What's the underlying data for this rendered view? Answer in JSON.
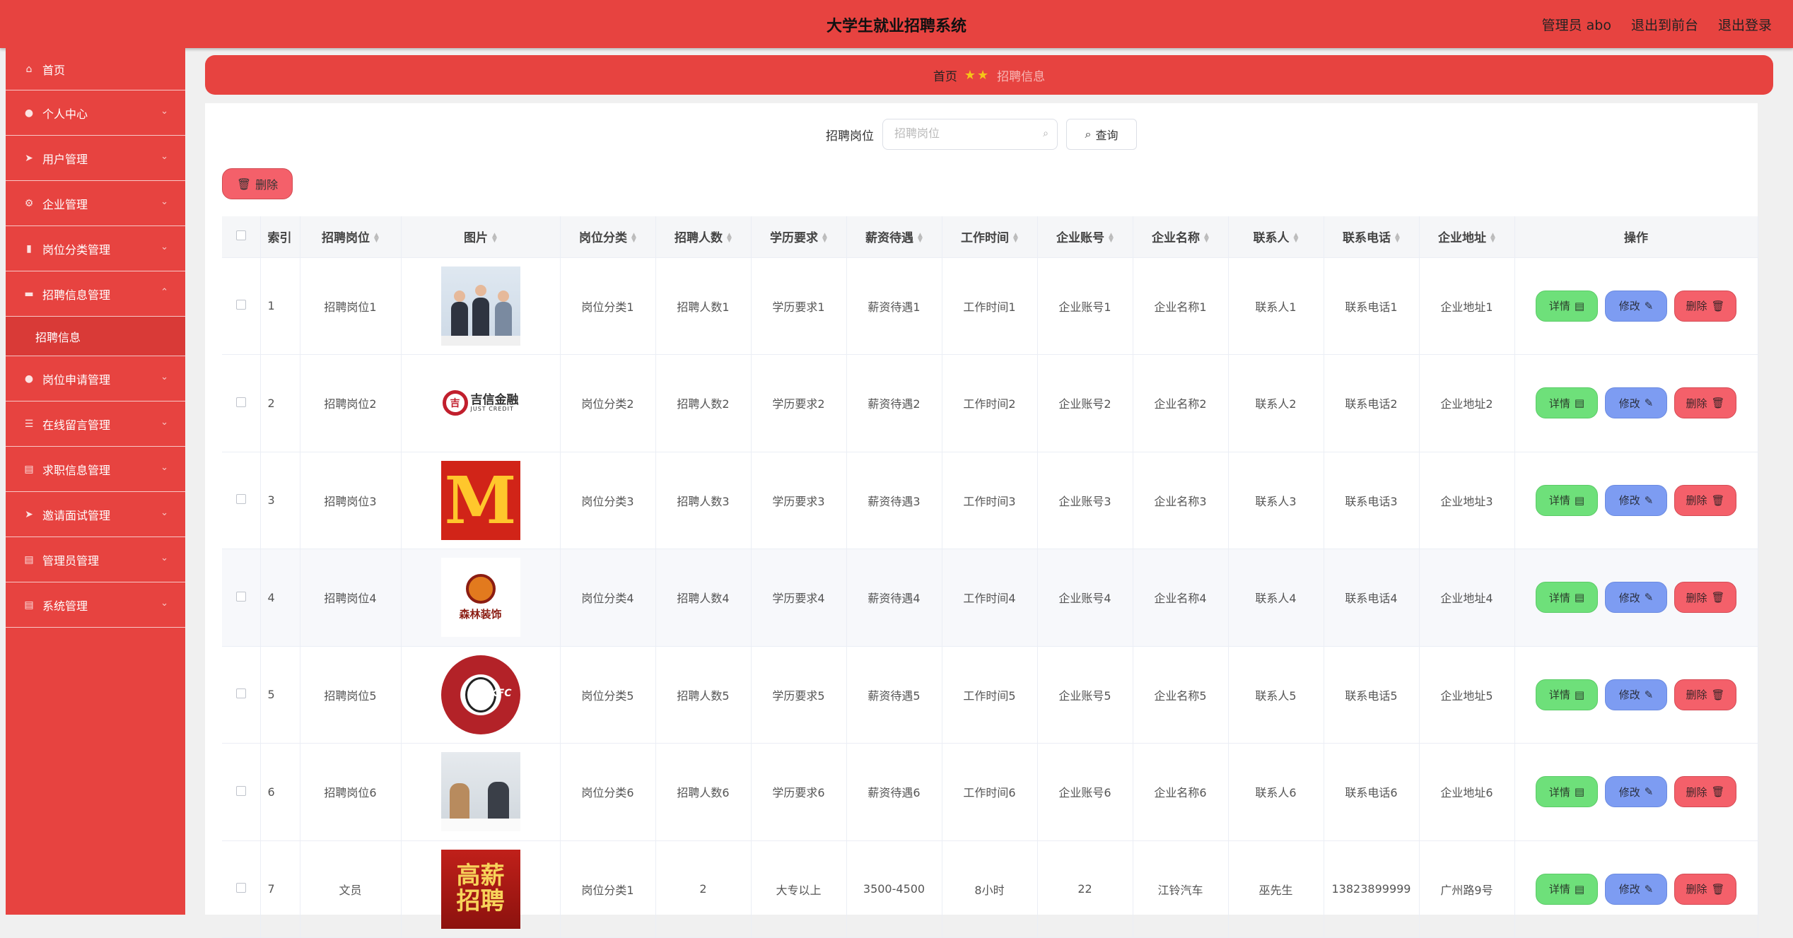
{
  "header": {
    "title": "大学生就业招聘系统",
    "admin": "管理员 abo",
    "exit_front": "退出到前台",
    "logout": "退出登录"
  },
  "sidebar": {
    "items": [
      {
        "label": "首页",
        "icon": "home-icon"
      },
      {
        "label": "个人中心",
        "icon": "user-icon"
      },
      {
        "label": "用户管理",
        "icon": "send-icon"
      },
      {
        "label": "企业管理",
        "icon": "gear-icon"
      },
      {
        "label": "岗位分类管理",
        "icon": "bar-chart-icon"
      },
      {
        "label": "招聘信息管理",
        "icon": "briefcase-icon"
      },
      {
        "label": "岗位申请管理",
        "icon": "location-icon"
      },
      {
        "label": "在线留言管理",
        "icon": "menu-icon"
      },
      {
        "label": "求职信息管理",
        "icon": "clipboard-icon"
      },
      {
        "label": "邀请面试管理",
        "icon": "send-icon"
      },
      {
        "label": "管理员管理",
        "icon": "clipboard-icon"
      },
      {
        "label": "系统管理",
        "icon": "clipboard-icon"
      }
    ],
    "sub_item": "招聘信息"
  },
  "breadcrumb": {
    "home": "首页",
    "current": "招聘信息"
  },
  "search": {
    "label": "招聘岗位",
    "placeholder": "招聘岗位",
    "button": "查询"
  },
  "toolbar": {
    "delete": "删除"
  },
  "table": {
    "headers": [
      "索引",
      "招聘岗位",
      "图片",
      "岗位分类",
      "招聘人数",
      "学历要求",
      "薪资待遇",
      "工作时间",
      "企业账号",
      "企业名称",
      "联系人",
      "联系电话",
      "企业地址",
      "操作"
    ],
    "rows": [
      [
        "1",
        "招聘岗位1",
        "岗位分类1",
        "招聘人数1",
        "学历要求1",
        "薪资待遇1",
        "工作时间1",
        "企业账号1",
        "企业名称1",
        "联系人1",
        "联系电话1",
        "企业地址1"
      ],
      [
        "2",
        "招聘岗位2",
        "岗位分类2",
        "招聘人数2",
        "学历要求2",
        "薪资待遇2",
        "工作时间2",
        "企业账号2",
        "企业名称2",
        "联系人2",
        "联系电话2",
        "企业地址2"
      ],
      [
        "3",
        "招聘岗位3",
        "岗位分类3",
        "招聘人数3",
        "学历要求3",
        "薪资待遇3",
        "工作时间3",
        "企业账号3",
        "企业名称3",
        "联系人3",
        "联系电话3",
        "企业地址3"
      ],
      [
        "4",
        "招聘岗位4",
        "岗位分类4",
        "招聘人数4",
        "学历要求4",
        "薪资待遇4",
        "工作时间4",
        "企业账号4",
        "企业名称4",
        "联系人4",
        "联系电话4",
        "企业地址4"
      ],
      [
        "5",
        "招聘岗位5",
        "岗位分类5",
        "招聘人数5",
        "学历要求5",
        "薪资待遇5",
        "工作时间5",
        "企业账号5",
        "企业名称5",
        "联系人5",
        "联系电话5",
        "企业地址5"
      ],
      [
        "6",
        "招聘岗位6",
        "岗位分类6",
        "招聘人数6",
        "学历要求6",
        "薪资待遇6",
        "工作时间6",
        "企业账号6",
        "企业名称6",
        "联系人6",
        "联系电话6",
        "企业地址6"
      ],
      [
        "7",
        "文员",
        "岗位分类1",
        "2",
        "大专以上",
        "3500-4500",
        "8小时",
        "22",
        "江铃汽车",
        "巫先生",
        "13823899999",
        "广州路9号"
      ]
    ],
    "images": {
      "jixin_cn": "吉信金融",
      "jixin_en": "JUST CREDIT",
      "mcd": "M",
      "deco_cn": "森林装饰",
      "kfc": "KFC",
      "gx1": "高薪",
      "gx2": "招聘"
    },
    "ops": {
      "detail": "详情",
      "edit": "修改",
      "delete": "删除"
    }
  },
  "colors": {
    "primary": "#e74340",
    "detail": "#6ee07a",
    "edit": "#7d9cf2",
    "delete": "#f4606a"
  }
}
